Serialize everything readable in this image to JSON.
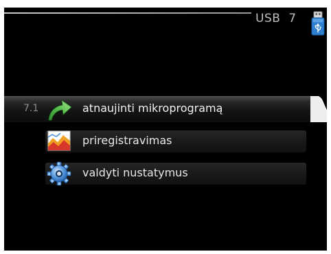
{
  "header": {
    "title": "USB",
    "menu_number": "7",
    "usb_icon": "usb-stick-icon"
  },
  "menu": {
    "items": [
      {
        "number": "7.1",
        "label": "atnaujinti mikroprogramą",
        "icon": "green-arrow-icon",
        "selected": true
      },
      {
        "number": "",
        "label": "priregistravimas",
        "icon": "chart-log-icon",
        "selected": false
      },
      {
        "number": "",
        "label": "valdyti nustatymus",
        "icon": "gear-icon",
        "selected": false
      }
    ]
  },
  "colors": {
    "background": "#000000",
    "text": "#e8e8e8",
    "selected_bar": "#2a2a2a",
    "usb_blue": "#2f7fd1",
    "arrow_green": "#4cb84a"
  }
}
